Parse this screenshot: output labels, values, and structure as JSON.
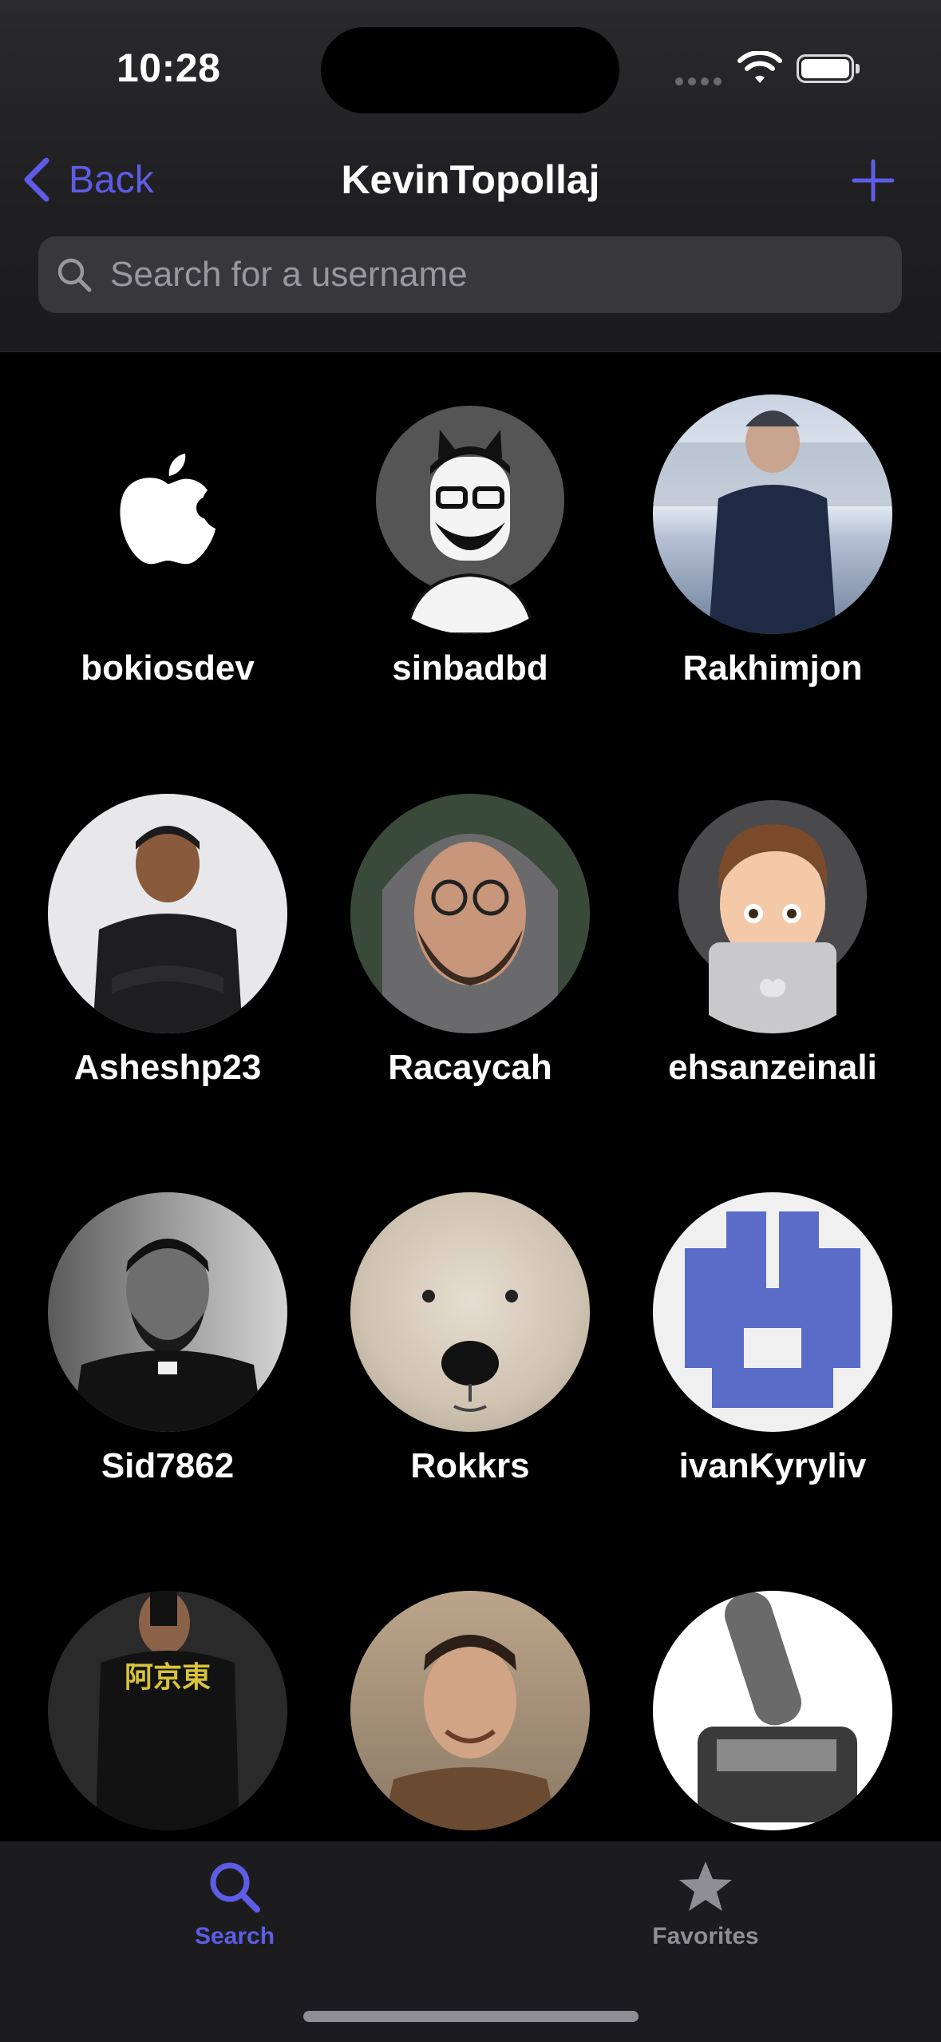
{
  "status_bar": {
    "time": "10:28"
  },
  "nav": {
    "back_label": "Back",
    "title": "KevinTopollaj",
    "add_icon": "plus-icon"
  },
  "search": {
    "placeholder": "Search for a username",
    "value": ""
  },
  "colors": {
    "accent": "#5e5ce6",
    "background": "#000000",
    "tab_inactive": "#8e8e93"
  },
  "users": [
    {
      "username": "bokiosdev",
      "avatar": "apple-logo"
    },
    {
      "username": "sinbadbd",
      "avatar": "cartoon-cat-glasses"
    },
    {
      "username": "Rakhimjon",
      "avatar": "photo-snow-jacket"
    },
    {
      "username": "Asheshp23",
      "avatar": "photo-smiling-man"
    },
    {
      "username": "Racaycah",
      "avatar": "photo-hoodie-glasses"
    },
    {
      "username": "ehsanzeinali",
      "avatar": "memoji-laptop"
    },
    {
      "username": "Sid7862",
      "avatar": "photo-bw-man"
    },
    {
      "username": "Rokkrs",
      "avatar": "photo-polar-bear"
    },
    {
      "username": "ivanKyryliv",
      "avatar": "identicon-blue"
    },
    {
      "username": "",
      "avatar": "photo-mirror-selfie"
    },
    {
      "username": "",
      "avatar": "photo-smiling-man-2"
    },
    {
      "username": "",
      "avatar": "photo-toggle-switch"
    }
  ],
  "tabs": [
    {
      "label": "Search",
      "icon": "search-icon",
      "active": true
    },
    {
      "label": "Favorites",
      "icon": "star-icon",
      "active": false
    }
  ]
}
